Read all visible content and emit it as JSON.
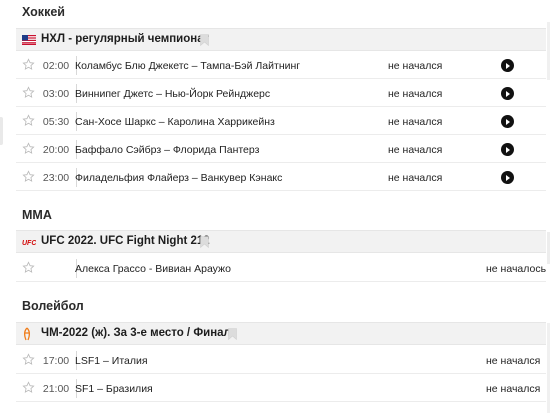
{
  "sections": [
    {
      "title": "Хоккей",
      "league": "НХЛ - регулярный чемпионат",
      "league_icon": "us-flag-icon",
      "matches": [
        {
          "time": "02:00",
          "teams": "Коламбус Блю Джекетс – Тампа-Бэй Лайтнинг",
          "status": "не начался"
        },
        {
          "time": "03:00",
          "teams": "Виннипег Джетс – Нью-Йорк Рейнджерс",
          "status": "не начался"
        },
        {
          "time": "05:30",
          "teams": "Сан-Хосе Шаркс – Каролина Харрикейнз",
          "status": "не начался"
        },
        {
          "time": "20:00",
          "teams": "Баффало Сэйбрз – Флорида Пантерз",
          "status": "не начался"
        },
        {
          "time": "23:00",
          "teams": "Филадельфия Флайерз – Ванкувер Кэнакс",
          "status": "не начался"
        }
      ]
    },
    {
      "title": "ММА",
      "league": "UFC 2022. UFC Fight Night 212",
      "league_icon": "ufc-logo-icon",
      "matches": [
        {
          "time": "",
          "teams": "Алекса Грассо - Вивиан Араужо",
          "status": "не началось"
        }
      ]
    },
    {
      "title": "Волейбол",
      "league": "ЧМ-2022 (ж). За 3-е место / Финал",
      "league_icon": "volleyball-championship-icon",
      "matches": [
        {
          "time": "17:00",
          "teams": "LSF1 – Италия",
          "status": "не начался"
        },
        {
          "time": "21:00",
          "teams": "SF1 – Бразилия",
          "status": "не начался"
        }
      ]
    }
  ],
  "colors": {
    "league_bar": "#f2f2f2",
    "ufc_red": "#d20a0a",
    "volleyball_orange": "#f07d1a",
    "play_button": "#111111"
  }
}
